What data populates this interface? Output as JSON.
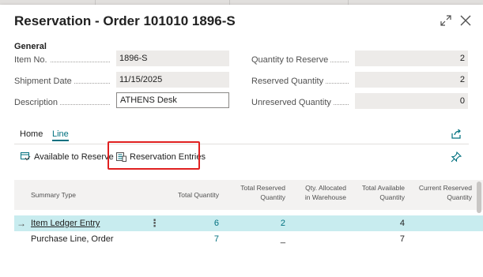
{
  "dialog": {
    "title": "Reservation - Order 101010 1896-S",
    "expand_icon": "expand-diagonal-arrows",
    "close_icon": "close-x"
  },
  "general": {
    "caption": "General",
    "left_fields": [
      {
        "label": "Item No.",
        "value": "1896-S"
      },
      {
        "label": "Shipment Date",
        "value": "11/15/2025"
      },
      {
        "label": "Description",
        "value": "ATHENS Desk"
      }
    ],
    "right_fields": [
      {
        "label": "Quantity to Reserve",
        "value": "2"
      },
      {
        "label": "Reserved Quantity",
        "value": "2"
      },
      {
        "label": "Unreserved Quantity",
        "value": "0"
      }
    ]
  },
  "tabs": [
    {
      "label": "Home",
      "active": false
    },
    {
      "label": "Line",
      "active": true
    }
  ],
  "actions": [
    {
      "label": "Available to Reserve",
      "icon": "available-to-reserve-icon"
    },
    {
      "label": "Reservation Entries",
      "icon": "reservation-entries-icon"
    }
  ],
  "grid": {
    "columns": [
      "Summary Type",
      "Total Quantity",
      "Total Reserved Quantity",
      "Qty. Allocated in Warehouse",
      "Total Available Quantity",
      "Current Reserved Quantity"
    ],
    "rows": [
      {
        "summary_type": "Item Ledger Entry",
        "total_quantity": "6",
        "total_reserved": "2",
        "qty_allocated": "",
        "total_available": "4",
        "current_reserved": "",
        "selected": true
      },
      {
        "summary_type": "Purchase Line, Order",
        "total_quantity": "7",
        "total_reserved": "_",
        "qty_allocated": "",
        "total_available": "7",
        "current_reserved": "",
        "selected": false
      }
    ]
  },
  "colors": {
    "accent": "#00707f",
    "selected_row": "#c8ecef",
    "highlight_box": "#e02020"
  }
}
